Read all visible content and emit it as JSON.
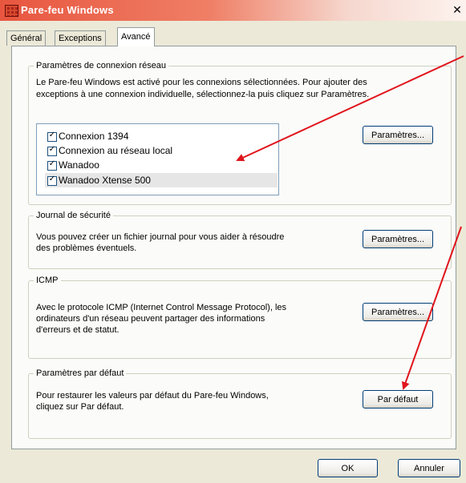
{
  "window": {
    "title": "Pare-feu Windows",
    "close_glyph": "✕"
  },
  "tabs": [
    {
      "label": "Général",
      "active": false
    },
    {
      "label": "Exceptions",
      "active": false
    },
    {
      "label": "Avancé",
      "active": true
    }
  ],
  "network": {
    "legend": "Paramètres de connexion réseau",
    "description_line1": "Le Pare-feu Windows est activé pour les connexions sélectionnées. Pour ajouter des",
    "description_line2": "exceptions à une connexion individuelle, sélectionnez-la puis cliquez sur Paramètres.",
    "connections": [
      {
        "label": "Connexion 1394",
        "checked": true,
        "selected": false
      },
      {
        "label": "Connexion au réseau local",
        "checked": true,
        "selected": false
      },
      {
        "label": "Wanadoo",
        "checked": true,
        "selected": false
      },
      {
        "label": "Wanadoo Xtense 500",
        "checked": true,
        "selected": true
      }
    ],
    "settings_button": "Paramètres..."
  },
  "security_log": {
    "legend": "Journal de sécurité",
    "description_line1": "Vous pouvez créer un fichier journal pour vous aider à résoudre",
    "description_line2": "des problèmes éventuels.",
    "settings_button": "Paramètres..."
  },
  "icmp": {
    "legend": "ICMP",
    "description_line1": "Avec le protocole ICMP (Internet Control Message Protocol), les",
    "description_line2": "ordinateurs d'un réseau peuvent partager des informations",
    "description_line3": "d'erreurs et de statut.",
    "settings_button": "Paramètres..."
  },
  "defaults": {
    "legend": "Paramètres par défaut",
    "description_line1": "Pour restaurer les valeurs par défaut du Pare-feu Windows,",
    "description_line2": "cliquez sur Par défaut.",
    "default_button": "Par défaut"
  },
  "footer": {
    "ok_button": "OK",
    "cancel_button": "Annuler"
  },
  "colors": {
    "annotation_arrow": "#e0141c",
    "titlebar_start": "#e8563f"
  },
  "check_glyph": "✓"
}
